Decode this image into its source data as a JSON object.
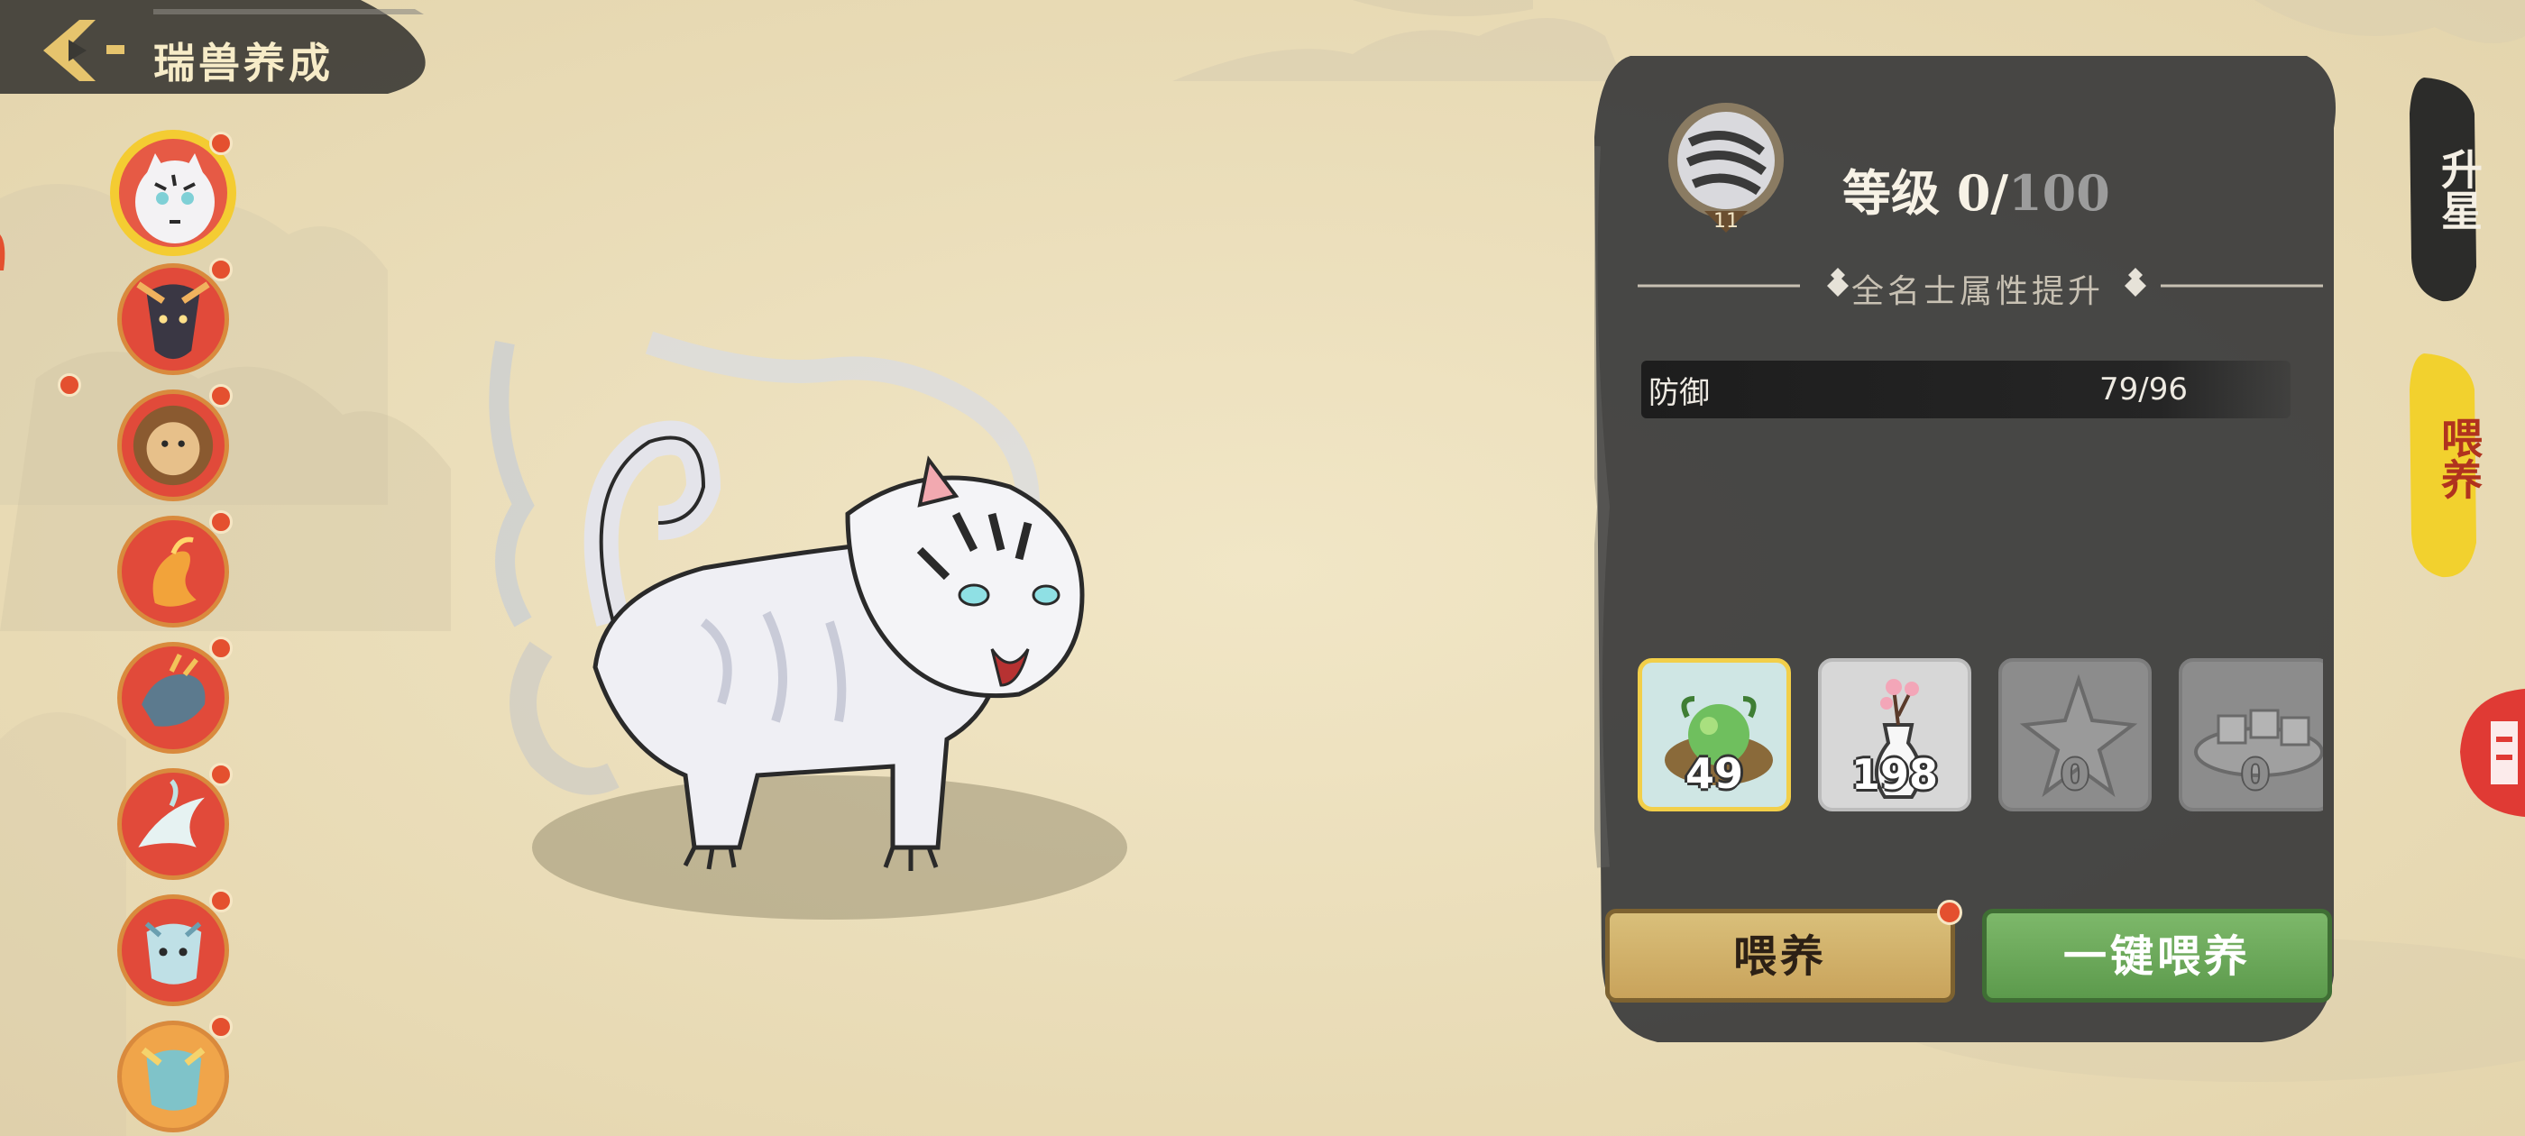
{
  "header": {
    "back_icon": "back-arrow-icon",
    "title": "瑞兽养成"
  },
  "beasts": [
    {
      "name": "white-tiger",
      "selected": true,
      "has_notice": true
    },
    {
      "name": "black-dragon",
      "selected": false,
      "has_notice": true
    },
    {
      "name": "lion",
      "selected": false,
      "has_notice": true
    },
    {
      "name": "phoenix",
      "selected": false,
      "has_notice": true
    },
    {
      "name": "qilin",
      "selected": false,
      "has_notice": true
    },
    {
      "name": "crane",
      "selected": false,
      "has_notice": true
    },
    {
      "name": "azure-dragon",
      "selected": false,
      "has_notice": true
    },
    {
      "name": "golden-dragon",
      "selected": false,
      "has_notice": true
    }
  ],
  "panel": {
    "badge_level": "11",
    "level_prefix": "等级 ",
    "level_current": "0/",
    "level_max": "100",
    "section_title": "全名士属性提升",
    "stat": {
      "name": "防御",
      "value": "79/96"
    },
    "items": [
      {
        "icon": "green-orb-food-icon",
        "count": "49",
        "active": true
      },
      {
        "icon": "plum-blossom-vase-icon",
        "count": "198",
        "active": false
      },
      {
        "icon": "crystal-star-icon",
        "count": "0",
        "active": false
      },
      {
        "icon": "cake-plate-icon",
        "count": "0",
        "active": false
      }
    ],
    "feed_button": "喂养",
    "feed_all_button": "一键喂养"
  },
  "tabs": {
    "star_up": "升星",
    "feed": "喂养"
  },
  "colors": {
    "background": "#ece0bd",
    "panel": "#3e3e3e",
    "accent_yellow": "#f4cc32",
    "notice_red": "#e4502f",
    "feed_all_green": "#5c9a4c"
  }
}
